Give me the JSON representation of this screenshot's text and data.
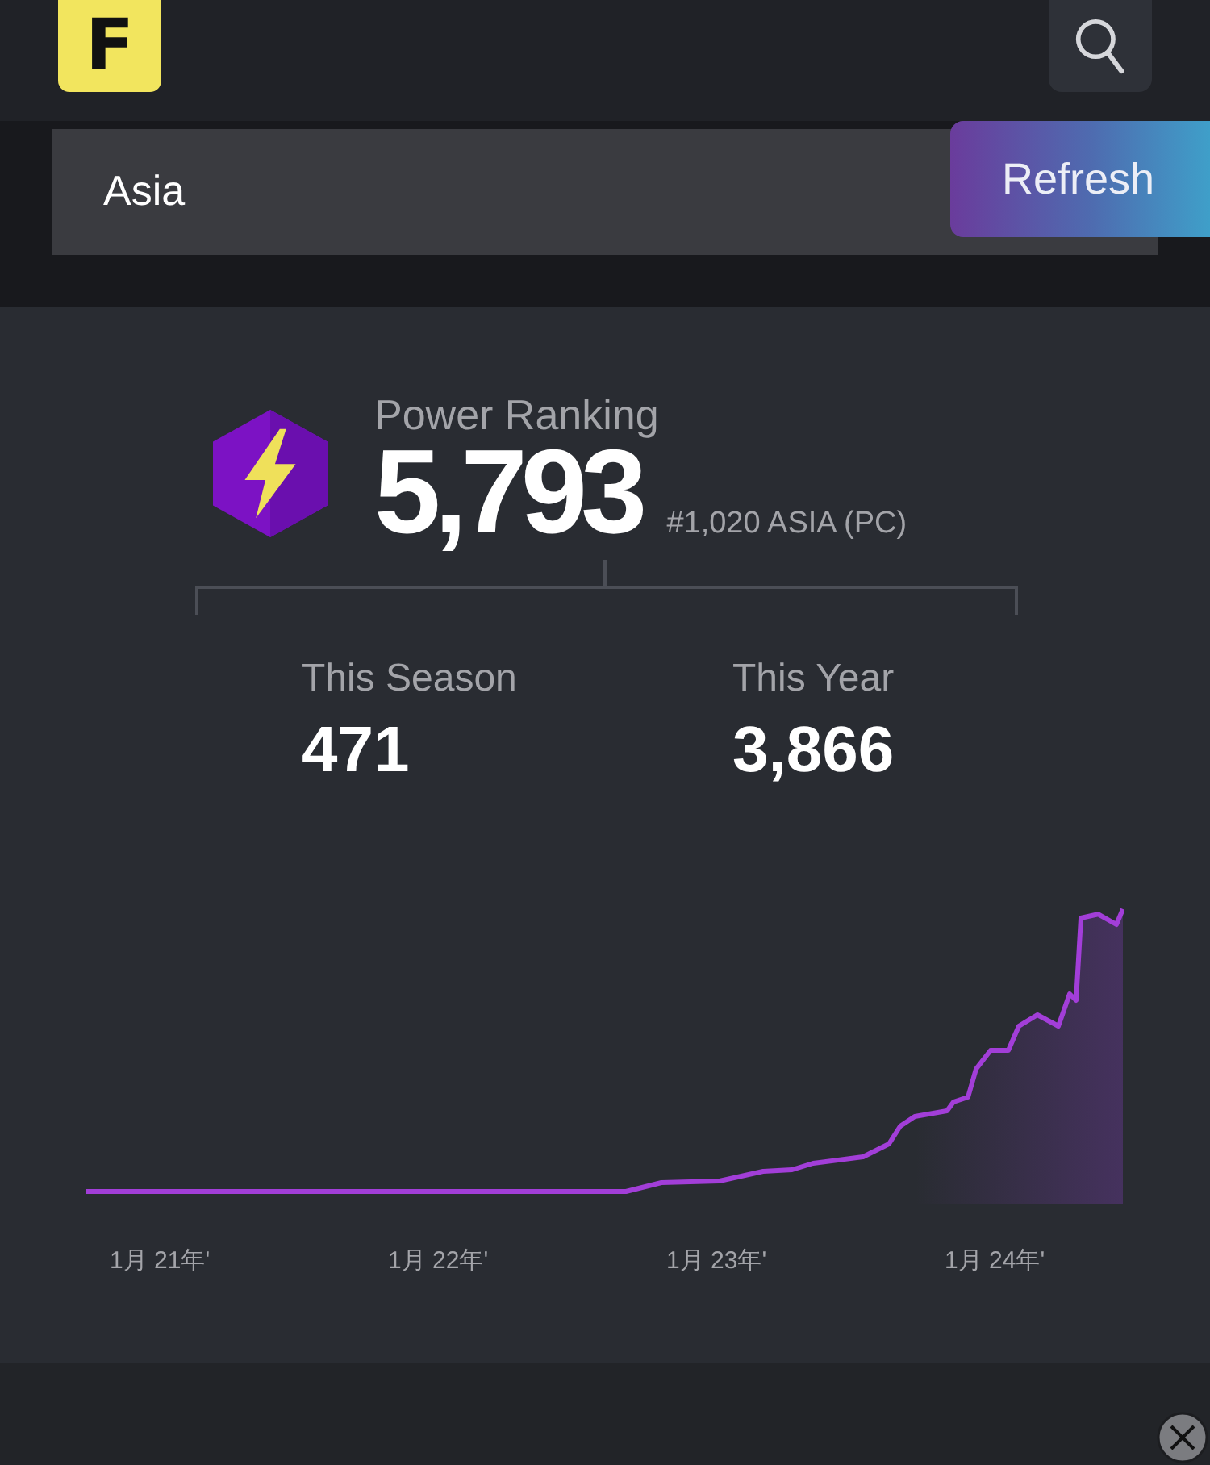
{
  "header": {
    "logo": "F"
  },
  "region_field": {
    "value": "Asia"
  },
  "refresh_button": {
    "label": "Refresh"
  },
  "power_ranking": {
    "title": "Power Ranking",
    "points": "5,793",
    "rank": "#1,020 ASIA (PC)"
  },
  "stats": [
    {
      "label": "This Season",
      "value": "471"
    },
    {
      "label": "This Year",
      "value": "3,866"
    }
  ],
  "chart": {
    "x_labels": [
      "1月 21年'",
      "1月 22年'",
      "1月 23年'",
      "1月 24年'"
    ]
  }
}
